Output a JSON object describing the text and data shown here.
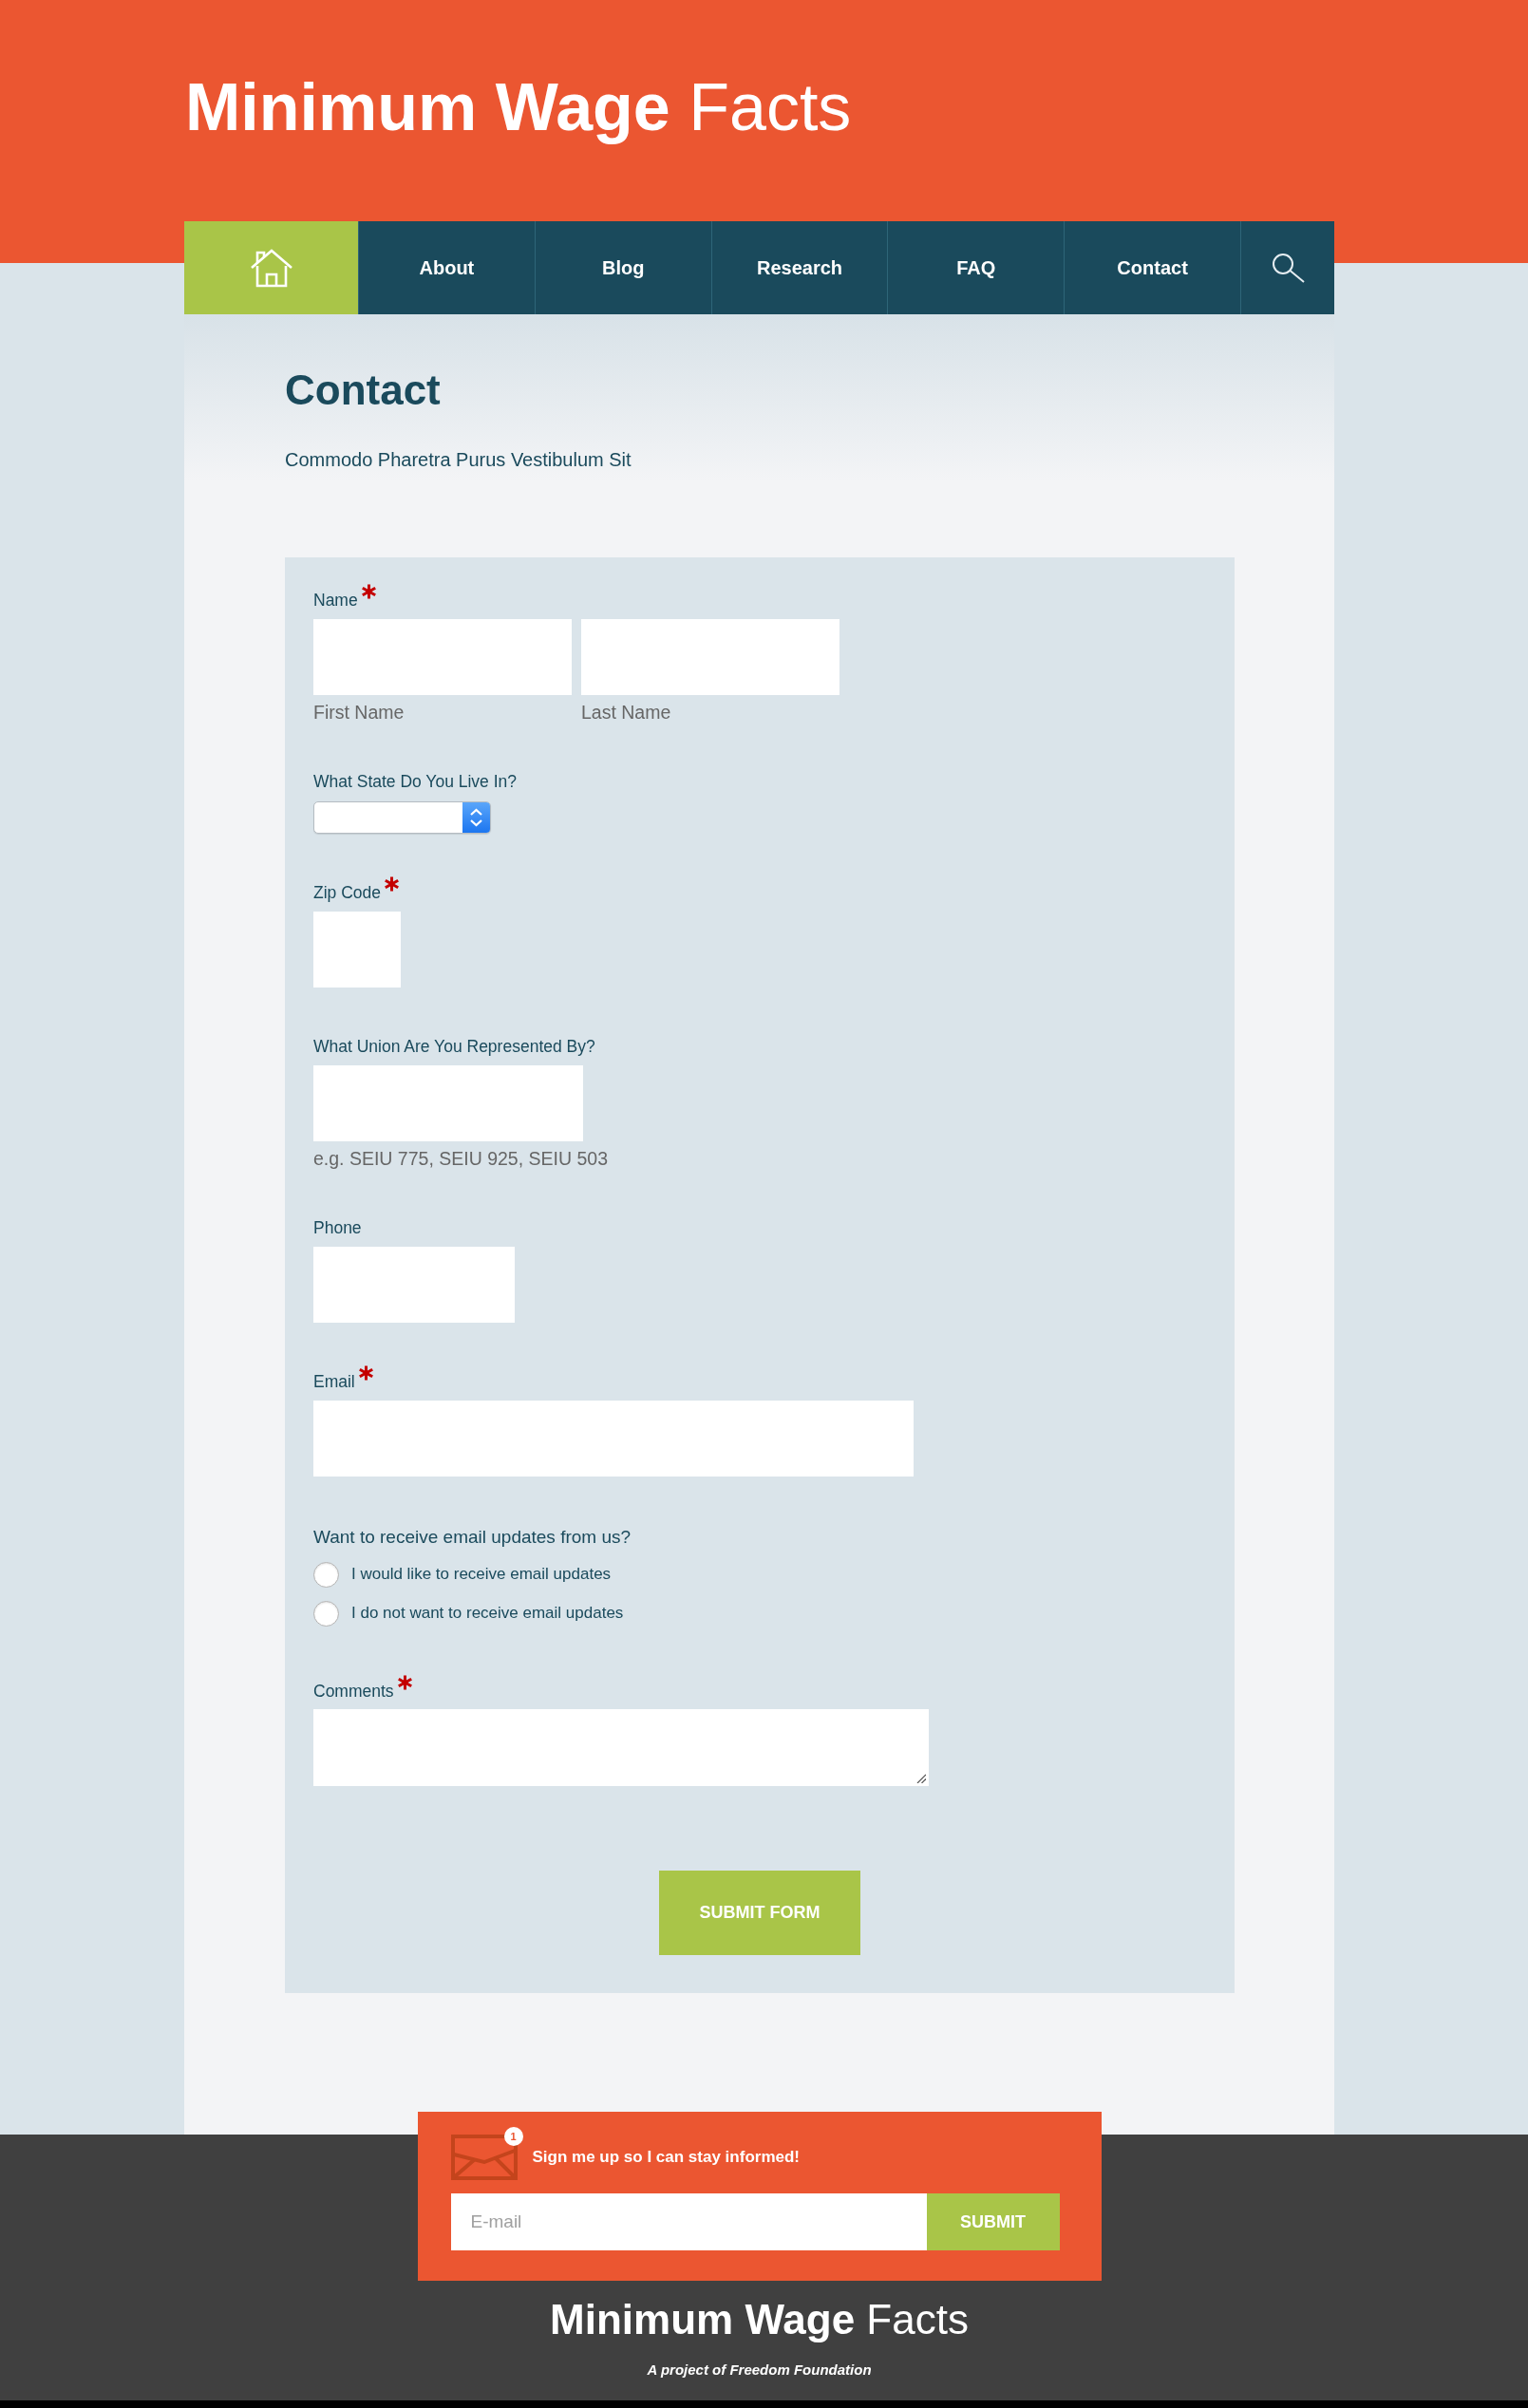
{
  "header": {
    "title": "**Minimum Wage** Facts"
  },
  "nav": {
    "items": [
      {
        "kind": "home"
      },
      {
        "kind": "link",
        "label": "About"
      },
      {
        "kind": "link",
        "label": "Blog"
      },
      {
        "kind": "link",
        "label": "Research"
      },
      {
        "kind": "link",
        "label": "FAQ"
      },
      {
        "kind": "link",
        "label": "Contact"
      },
      {
        "kind": "search"
      }
    ]
  },
  "page": {
    "title": "Contact",
    "subtitle": "Commodo Pharetra Purus Vestibulum Sit"
  },
  "form": {
    "fields": [
      {
        "kind": "name",
        "label": "Name",
        "required": true,
        "parts": [
          {
            "sublabel": "First Name"
          },
          {
            "sublabel": "Last Name"
          }
        ]
      },
      {
        "kind": "select",
        "label": "What State Do You Live In?",
        "required": false
      },
      {
        "kind": "zip",
        "label": "Zip Code",
        "required": true
      },
      {
        "kind": "text",
        "label": "What Union Are You Represented By?",
        "required": false,
        "hint": "e.g. SEIU 775, SEIU 925, SEIU 503"
      },
      {
        "kind": "phone",
        "label": "Phone",
        "required": false
      },
      {
        "kind": "email",
        "label": "Email",
        "required": true
      },
      {
        "kind": "radio",
        "label": "Want to receive email updates from us?",
        "required": false,
        "options": [
          {
            "label": "I would like to receive email updates",
            "selected": false
          },
          {
            "label": "I do not want to receive email updates",
            "selected": false
          }
        ]
      },
      {
        "kind": "textarea",
        "label": "Comments",
        "required": true
      }
    ],
    "submit": "SUBMIT FORM"
  },
  "newsletter": {
    "badge": "1",
    "text": "Sign me up so I can stay informed!",
    "placeholder": "E-mail",
    "button": "SUBMIT"
  },
  "footer": {
    "title": "**Minimum Wage** Facts",
    "tagline": "A project of Freedom Foundation"
  }
}
